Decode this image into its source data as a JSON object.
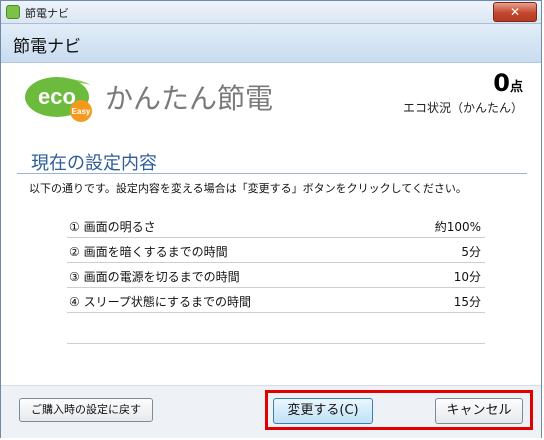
{
  "window": {
    "title": "節電ナビ",
    "close_label": "✕"
  },
  "header": {
    "title": "節電ナビ"
  },
  "logo": {
    "eco": "eco",
    "easy": "Easy",
    "title": "かんたん節電"
  },
  "score": {
    "value": "0",
    "unit": "点",
    "label": "エコ状況（かんたん）"
  },
  "section": {
    "title": "現在の設定内容",
    "description": "以下の通りです。設定内容を変える場合は「変更する」ボタンをクリックしてください。"
  },
  "settings": [
    {
      "label": "① 画面の明るさ",
      "value": "約100%"
    },
    {
      "label": "② 画面を暗くするまでの時間",
      "value": "5分"
    },
    {
      "label": "③ 画面の電源を切るまでの時間",
      "value": "10分"
    },
    {
      "label": "④ スリープ状態にするまでの時間",
      "value": "15分"
    }
  ],
  "buttons": {
    "restore": "ご購入時の設定に戻す",
    "change": "変更する(C)",
    "cancel": "キャンセル"
  },
  "colors": {
    "accent": "#2e5d9a",
    "eco_green": "#6cbb3c",
    "easy_orange": "#f39a1e",
    "highlight": "#e00000"
  }
}
